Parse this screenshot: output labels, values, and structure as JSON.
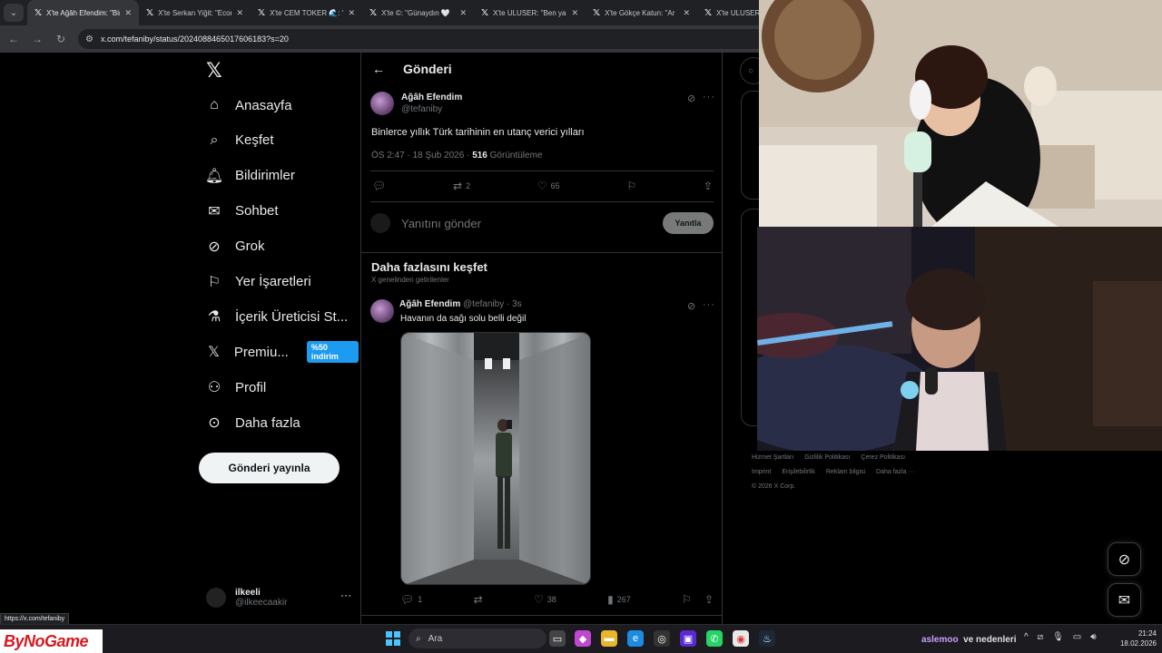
{
  "browser": {
    "tabs": [
      {
        "label": "X'te Ağâh Efendim: \"Binlerce",
        "active": true
      },
      {
        "label": "X'te Serkan Yiğit: \"Econ",
        "active": false
      },
      {
        "label": "X'te CEM TOKER 🌊: \"",
        "active": false
      },
      {
        "label": "X'te ©: \"Günaydın 🤍",
        "active": false
      },
      {
        "label": "X'te ULUSER: \"Ben ya",
        "active": false
      },
      {
        "label": "X'te Gökçe Katun: \"Ar",
        "active": false
      },
      {
        "label": "X'te ULUSER: \"",
        "active": false
      }
    ],
    "url": "x.com/tefaniby/status/2024088465017606183?s=20",
    "status_url": "https://x.com/tefaniby"
  },
  "nav": {
    "items": [
      {
        "label": "Anasayfa",
        "icon": "home-icon"
      },
      {
        "label": "Keşfet",
        "icon": "search-icon"
      },
      {
        "label": "Bildirimler",
        "icon": "bell-icon"
      },
      {
        "label": "Sohbet",
        "icon": "mail-icon"
      },
      {
        "label": "Grok",
        "icon": "grok-icon"
      },
      {
        "label": "Yer İşaretleri",
        "icon": "bookmark-icon"
      },
      {
        "label": "İçerik Üreticisi St...",
        "icon": "creator-studio-icon"
      },
      {
        "label": "Premiu...",
        "icon": "x-icon"
      },
      {
        "label": "Profil",
        "icon": "person-icon"
      },
      {
        "label": "Daha fazla",
        "icon": "more-circle-icon"
      }
    ],
    "premium_badge": "%50 indirim",
    "post_button": "Gönderi yayınla",
    "account": {
      "name": "ilkeeli",
      "handle": "@ilkeecaakir"
    }
  },
  "post": {
    "header_title": "Gönderi",
    "author_name": "Ağâh Efendim",
    "author_handle": "@tefaniby",
    "text": "Binlerce yıllık Türk tarihinin en utanç verici yılları",
    "time": "ÖS 2:47 · 18 Şub 2026 · ",
    "views": "516",
    "views_label": " Görüntüleme",
    "retweets": "2",
    "likes": "65",
    "reply_placeholder": "Yanıtını gönder",
    "reply_button": "Yanıtla"
  },
  "discover": {
    "title": "Daha fazlasını keşfet",
    "subtitle": "X genelinden getirilenler",
    "post": {
      "author_name": "Ağâh Efendim",
      "meta": "@tefaniby · 3s",
      "text": "Havanın da sağı solu belli değil",
      "replies": "1",
      "likes": "38",
      "views": "267"
    }
  },
  "right": {
    "footer": [
      "Hizmet Şartları",
      "Gizlilik Politikası",
      "Çerez Politikası",
      "Imprint",
      "Erişilebilirlik",
      "Reklam bilgisi",
      "Daha fazla ···",
      "© 2026 X Corp."
    ]
  },
  "taskbar": {
    "brand": "ByNoGame",
    "search_placeholder": "Ara",
    "tray_user": "aslemoo",
    "tray_text": "ve nedenleri",
    "time": "21:24",
    "date": "18.02.2026"
  },
  "colors": {
    "accent": "#1d9bf0",
    "background": "#000000",
    "text_primary": "#e7e9ea",
    "text_secondary": "#71767b",
    "border": "#2f3336"
  }
}
